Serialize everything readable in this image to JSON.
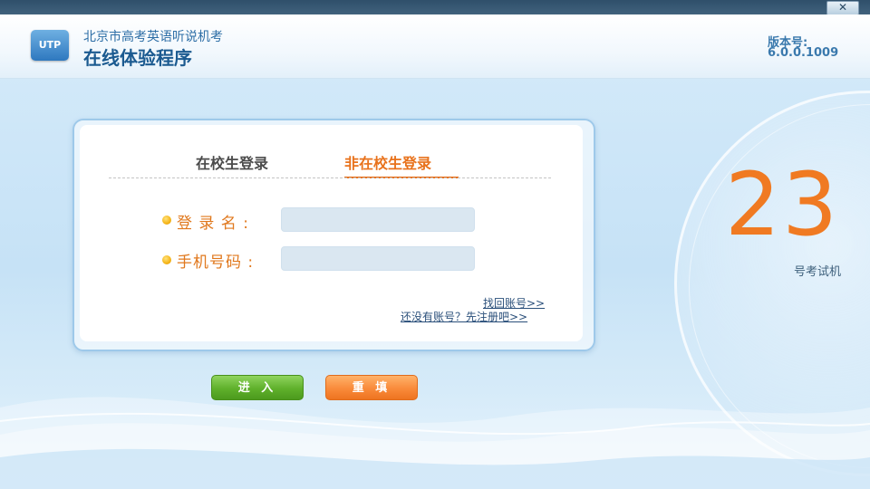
{
  "window": {
    "close_label": "✕"
  },
  "header": {
    "logo_text": "UTP",
    "subtitle": "北京市高考英语听说机考",
    "title": "在线体验程序",
    "version_label": "版本号:",
    "version_value": "6.0.0.1009"
  },
  "login": {
    "tabs": [
      {
        "label": "在校生登录",
        "active": false
      },
      {
        "label": "非在校生登录",
        "active": true
      }
    ],
    "fields": [
      {
        "label": "登 录 名 :",
        "value": "",
        "placeholder": ""
      },
      {
        "label": "手机号码 :",
        "value": "",
        "placeholder": ""
      }
    ],
    "links": {
      "recover": "找回账号>>",
      "register": "还没有账号？先注册吧>>"
    }
  },
  "buttons": {
    "enter": "进 入",
    "reset": "重 填"
  },
  "seat": {
    "number": "23",
    "caption": "号考试机"
  },
  "colors": {
    "accent_orange": "#e8721c",
    "title_blue": "#1b5a90",
    "enter_green": "#5fb02b",
    "reset_orange": "#f98a3a"
  }
}
